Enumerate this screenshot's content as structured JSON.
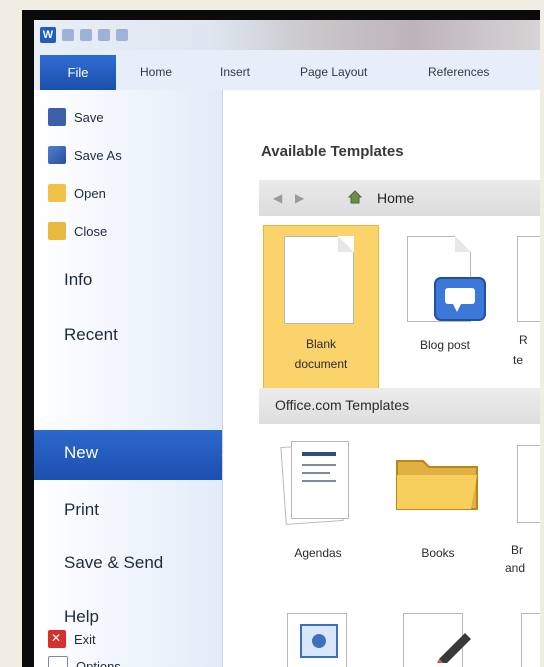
{
  "ribbon": {
    "app_icon_letter": "W",
    "tabs": [
      "File",
      "Home",
      "Insert",
      "Page Layout",
      "References"
    ]
  },
  "backstage": {
    "top_items": [
      "Save",
      "Save As",
      "Open",
      "Close"
    ],
    "sections": [
      "Info",
      "Recent",
      "New",
      "Print",
      "Save & Send",
      "Help"
    ],
    "bottom_items": [
      "Options",
      "Exit"
    ],
    "selected": "New"
  },
  "templates": {
    "available_heading": "Available Templates",
    "nav_location": "Home",
    "tiles": [
      {
        "label_line1": "Blank",
        "label_line2": "document"
      },
      {
        "label_line1": "Blog post"
      }
    ],
    "partial_labels": [
      "R",
      "te"
    ],
    "office_heading": "Office.com Templates",
    "office_tiles": [
      "Agendas",
      "Books"
    ],
    "office_partial": [
      "Br",
      "and"
    ]
  },
  "colors": {
    "accent": "#1c4fb0",
    "selection": "#fbd36b"
  }
}
